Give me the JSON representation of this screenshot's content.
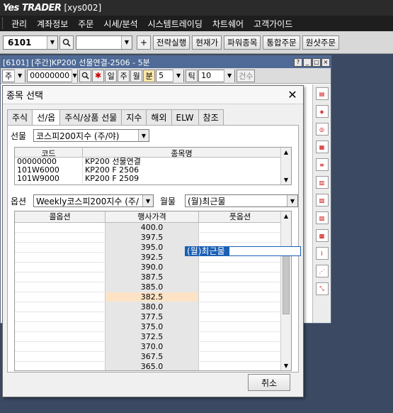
{
  "app": {
    "logo_text": "Yes TRADER",
    "user_id": "[xys002]"
  },
  "menu": {
    "items": [
      "관리",
      "계좌정보",
      "주문",
      "시세/분석",
      "시스템트레이딩",
      "차트쉐어",
      "고객가이드"
    ]
  },
  "toolbar": {
    "screen_no": "6101",
    "search_value": "",
    "buttons": [
      "전략실행",
      "현재가",
      "파워종목",
      "통합주문",
      "원샷주문"
    ]
  },
  "chart_window": {
    "title": "[6101] [주간]KP200 선물연결-2506 - 5분",
    "period_type": "주",
    "code": "00000000",
    "period_buttons": [
      "일",
      "주",
      "월",
      "분"
    ],
    "active_period": "분",
    "interval": "5",
    "tick_label": "틱",
    "tick_value": "10",
    "count_label": "건수",
    "window_buttons": [
      "?",
      "_",
      "□",
      "×"
    ]
  },
  "dialog": {
    "title": "종목 선택",
    "close_glyph": "✕",
    "tabs": [
      "주식",
      "선/옵",
      "주식/상품 선물",
      "지수",
      "해외",
      "ELW",
      "참조"
    ],
    "active_tab": 1,
    "futures_label": "선물",
    "futures_value": "코스피200지수 (주/야)",
    "code_table": {
      "headers": [
        "코드",
        "종목명"
      ],
      "rows": [
        [
          "00000000",
          "KP200 선물연결"
        ],
        [
          "101W6000",
          "KP200 F 2506"
        ],
        [
          "101W9000",
          "KP200 F 2509"
        ]
      ]
    },
    "option_label": "옵션",
    "option_value": "Weekly코스피200지수 (주/",
    "month_label": "월물",
    "month_value": "(월)최근물",
    "month_options": [
      "(월)최근물"
    ],
    "option_grid": {
      "headers": [
        "콜옵션",
        "행사가격",
        "풋옵션"
      ],
      "strikes": [
        "400.0",
        "397.5",
        "395.0",
        "392.5",
        "390.0",
        "387.5",
        "385.0",
        "382.5",
        "380.0",
        "377.5",
        "375.0",
        "372.5",
        "370.0",
        "367.5",
        "365.0"
      ],
      "atm_strike": "382.5"
    },
    "cancel_label": "취소"
  }
}
